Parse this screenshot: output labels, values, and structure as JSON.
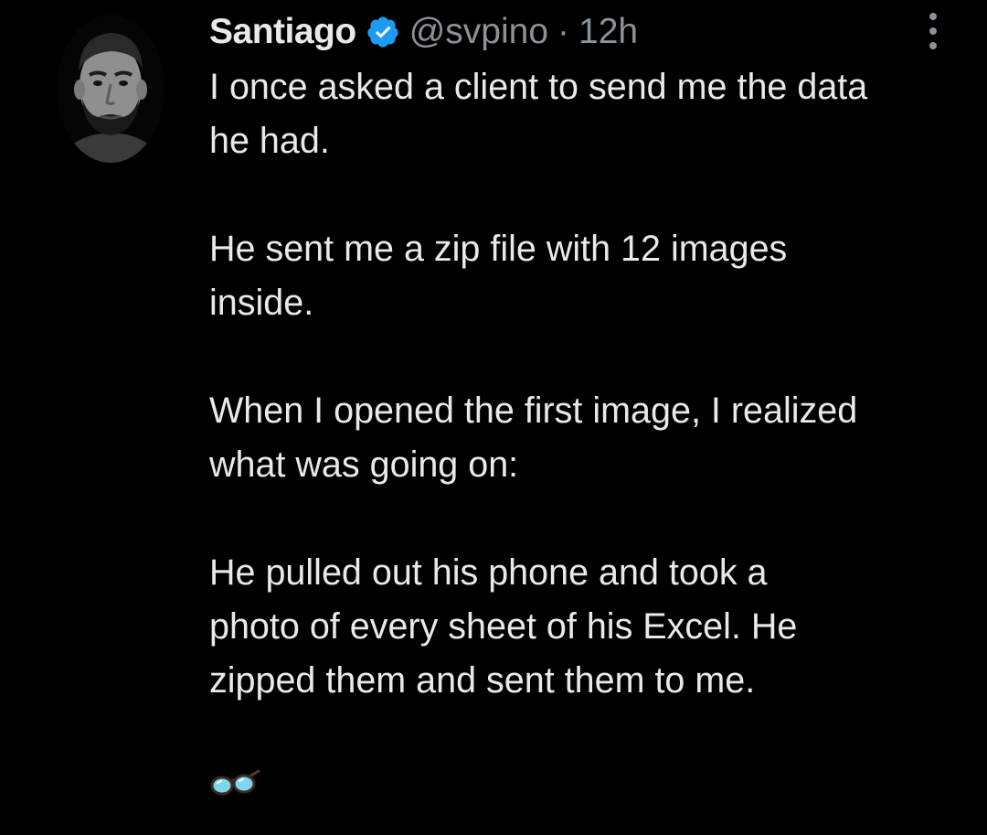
{
  "tweet": {
    "author_name": "Santiago",
    "handle": "@svpino",
    "separator": "·",
    "time": "12h",
    "icons": {
      "verified": "verified-badge-icon",
      "more": "more-options-icon",
      "emoji": "eyeglasses-emoji"
    },
    "colors": {
      "background": "#000000",
      "text": "#e7e9ea",
      "muted": "#8b9298",
      "verified": "#1d9bf0"
    },
    "body": {
      "p1_line1": "I once asked a client to send me the data",
      "p1_line2": "he had.",
      "p2_line1": "He sent me a zip file with 12 images",
      "p2_line2": "inside.",
      "p3_line1": "When I opened the first image, I realized",
      "p3_line2": "what was going on:",
      "p4_line1": "He pulled out his phone and took a",
      "p4_line2": "photo of every sheet of his Excel. He",
      "p4_line3": "zipped them and sent them to me."
    }
  }
}
